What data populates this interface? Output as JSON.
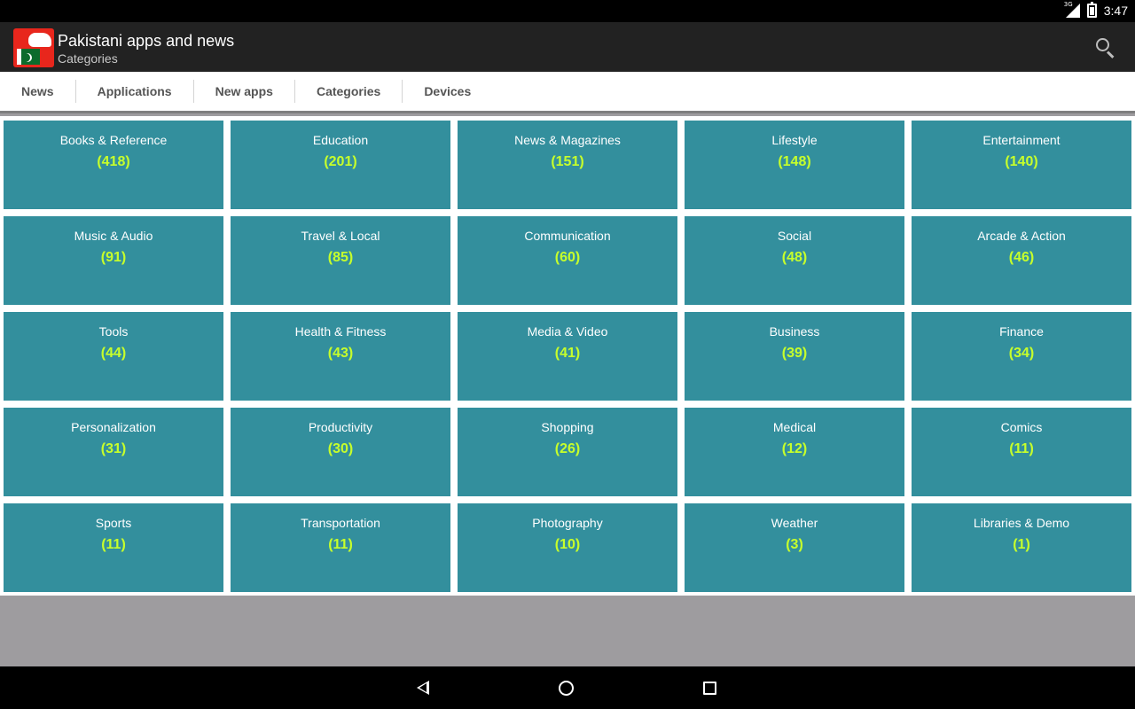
{
  "status_bar": {
    "network": "3G",
    "time": "3:47"
  },
  "action_bar": {
    "title": "Pakistani apps and news",
    "subtitle": "Categories",
    "search_icon": "search-icon"
  },
  "tabs": [
    "News",
    "Applications",
    "New apps",
    "Categories",
    "Devices"
  ],
  "categories": [
    {
      "name": "Books & Reference",
      "count": "(418)"
    },
    {
      "name": "Education",
      "count": "(201)"
    },
    {
      "name": "News & Magazines",
      "count": "(151)"
    },
    {
      "name": "Lifestyle",
      "count": "(148)"
    },
    {
      "name": "Entertainment",
      "count": "(140)"
    },
    {
      "name": "Music & Audio",
      "count": "(91)"
    },
    {
      "name": "Travel & Local",
      "count": "(85)"
    },
    {
      "name": "Communication",
      "count": "(60)"
    },
    {
      "name": "Social",
      "count": "(48)"
    },
    {
      "name": "Arcade & Action",
      "count": "(46)"
    },
    {
      "name": "Tools",
      "count": "(44)"
    },
    {
      "name": "Health & Fitness",
      "count": "(43)"
    },
    {
      "name": "Media & Video",
      "count": "(41)"
    },
    {
      "name": "Business",
      "count": "(39)"
    },
    {
      "name": "Finance",
      "count": "(34)"
    },
    {
      "name": "Personalization",
      "count": "(31)"
    },
    {
      "name": "Productivity",
      "count": "(30)"
    },
    {
      "name": "Shopping",
      "count": "(26)"
    },
    {
      "name": "Medical",
      "count": "(12)"
    },
    {
      "name": "Comics",
      "count": "(11)"
    },
    {
      "name": "Sports",
      "count": "(11)"
    },
    {
      "name": "Transportation",
      "count": "(11)"
    },
    {
      "name": "Photography",
      "count": "(10)"
    },
    {
      "name": "Weather",
      "count": "(3)"
    },
    {
      "name": "Libraries & Demo",
      "count": "(1)"
    }
  ],
  "colors": {
    "tile": "#338f9d",
    "count": "#c7ff2b",
    "action_bar": "#222222"
  }
}
